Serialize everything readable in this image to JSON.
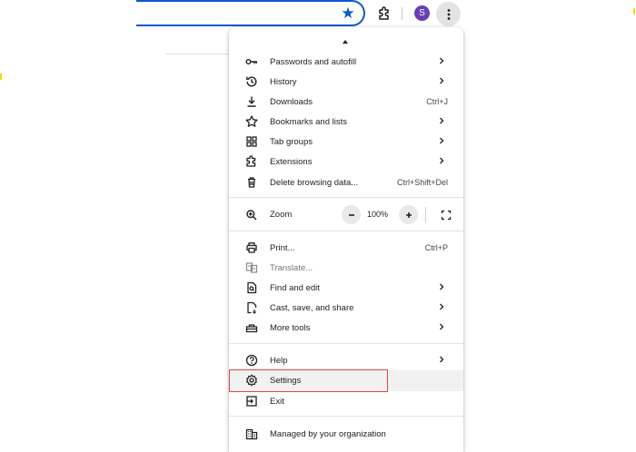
{
  "toolbar": {
    "avatar_initial": "S",
    "accent_color": "#0b57d0",
    "icons": [
      "star-icon",
      "extensions-icon",
      "avatar",
      "more-vert-icon"
    ]
  },
  "menu": {
    "items": [
      {
        "label": "Passwords and autofill",
        "icon": "key-icon",
        "submenu": true
      },
      {
        "label": "History",
        "icon": "history-icon",
        "submenu": true
      },
      {
        "label": "Downloads",
        "icon": "download-icon",
        "shortcut": "Ctrl+J"
      },
      {
        "label": "Bookmarks and lists",
        "icon": "star-outline-icon",
        "submenu": true
      },
      {
        "label": "Tab groups",
        "icon": "grid-icon",
        "submenu": true
      },
      {
        "label": "Extensions",
        "icon": "puzzle-icon",
        "submenu": true
      },
      {
        "label": "Delete browsing data...",
        "icon": "trash-icon",
        "shortcut": "Ctrl+Shift+Del"
      }
    ],
    "zoom": {
      "label": "Zoom",
      "value": "100%",
      "minus": "−",
      "plus": "+"
    },
    "items2": [
      {
        "label": "Print...",
        "icon": "printer-icon",
        "shortcut": "Ctrl+P"
      },
      {
        "label": "Translate...",
        "icon": "translate-icon",
        "disabled": true
      },
      {
        "label": "Find and edit",
        "icon": "find-icon",
        "submenu": true
      },
      {
        "label": "Cast, save, and share",
        "icon": "cast-icon",
        "submenu": true
      },
      {
        "label": "More tools",
        "icon": "toolbox-icon",
        "submenu": true
      }
    ],
    "items3": [
      {
        "label": "Help",
        "icon": "help-icon",
        "submenu": true
      },
      {
        "label": "Settings",
        "icon": "gear-icon",
        "highlighted": true
      },
      {
        "label": "Exit",
        "icon": "exit-icon"
      }
    ],
    "managed": {
      "label": "Managed by your organization",
      "icon": "building-icon"
    },
    "highlight_color": "#e04545"
  }
}
